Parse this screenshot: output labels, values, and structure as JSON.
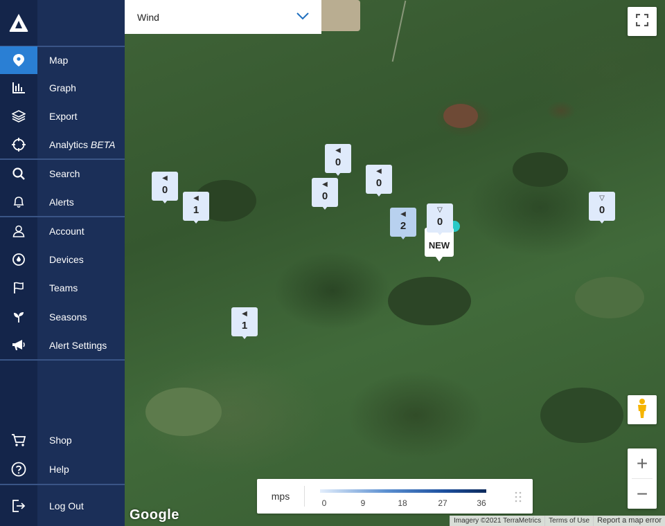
{
  "sidebar": {
    "logo": "app-logo",
    "items": [
      {
        "label": "Map",
        "icon": "map-pin-icon",
        "active": true
      },
      {
        "label": "Graph",
        "icon": "bar-chart-icon"
      },
      {
        "label": "Export",
        "icon": "layers-icon"
      },
      {
        "label": "Analytics",
        "label_suffix": "BETA",
        "icon": "crosshair-icon"
      },
      {
        "label": "Search",
        "icon": "search-icon"
      },
      {
        "label": "Alerts",
        "icon": "bell-icon"
      },
      {
        "label": "Account",
        "icon": "user-icon"
      },
      {
        "label": "Devices",
        "icon": "device-icon"
      },
      {
        "label": "Teams",
        "icon": "flag-icon"
      },
      {
        "label": "Seasons",
        "icon": "sprout-icon"
      },
      {
        "label": "Alert Settings",
        "icon": "megaphone-icon"
      },
      {
        "label": "Shop",
        "icon": "cart-icon"
      },
      {
        "label": "Help",
        "icon": "help-circle-icon"
      },
      {
        "label": "Log Out",
        "icon": "logout-icon"
      }
    ]
  },
  "map": {
    "layer_select": {
      "value": "Wind"
    },
    "markers": [
      {
        "value": "0",
        "arrow": "◀"
      },
      {
        "value": "1",
        "arrow": "◀"
      },
      {
        "value": "0",
        "arrow": "◀"
      },
      {
        "value": "0",
        "arrow": "◀"
      },
      {
        "value": "0",
        "arrow": "◀"
      },
      {
        "value": "2",
        "arrow": "◀"
      },
      {
        "value": "0",
        "arrow": "▽"
      },
      {
        "value": "0",
        "arrow": "▽"
      },
      {
        "value": "1",
        "arrow": "◀"
      }
    ],
    "new_marker": {
      "label": "NEW"
    },
    "legend": {
      "unit": "mps",
      "ticks": [
        "0",
        "9",
        "18",
        "27",
        "36"
      ]
    },
    "google_logo": "Google",
    "attribution": {
      "imagery": "Imagery ©2021 TerraMetrics",
      "terms": "Terms of Use",
      "report": "Report a map error"
    },
    "colors": {
      "sidebar": "#1b2f58",
      "active": "#2a7fd4",
      "marker_low": "#dfeafb",
      "marker_mid": "#b8d1ef",
      "new_dot": "#29c9c7"
    }
  }
}
